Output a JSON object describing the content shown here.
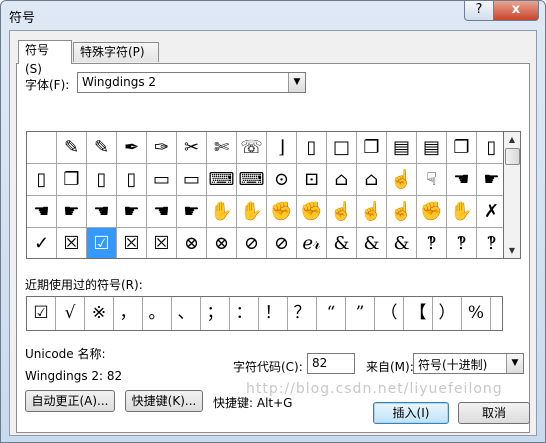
{
  "window": {
    "title": "符号",
    "help_icon": "?",
    "close_icon": "x"
  },
  "tabs": [
    {
      "label": "符号(S)",
      "active": true
    },
    {
      "label": "特殊字符(P)",
      "active": false
    }
  ],
  "font": {
    "label": "字体(F):",
    "value": "Wingdings 2"
  },
  "symbol_grid": {
    "rows": [
      [
        "",
        "✎",
        "✎",
        "✒",
        "✑",
        "✂",
        "✄",
        "☏",
        "⌋",
        "▯",
        "□",
        "❐",
        "▤",
        "▤",
        "❐",
        "▯"
      ],
      [
        "▯",
        "❐",
        "▯",
        "▯",
        "▭",
        "▭",
        "⌨",
        "⌨",
        "⊙",
        "⊡",
        "⌂",
        "⌂",
        "☝",
        "☟",
        "☚",
        "☛"
      ],
      [
        "☚",
        "☛",
        "☚",
        "☛",
        "☚",
        "☛",
        "✋",
        "✋",
        "✊",
        "✊",
        "☝",
        "☝",
        "☝",
        "✊",
        "✋",
        "✗"
      ],
      [
        "✓",
        "☒",
        "☑",
        "☒",
        "☒",
        "⊗",
        "⊗",
        "⊘",
        "⊘",
        "ℯ𝓇",
        "&",
        "&",
        "&",
        "‽",
        "‽",
        "‽"
      ]
    ],
    "selected": {
      "row": 3,
      "col": 2
    }
  },
  "recent": {
    "label": "近期使用过的符号(R):",
    "symbols": [
      "☑",
      "√",
      "※",
      "，",
      "。",
      "、",
      "；",
      "：",
      "！",
      "？",
      "“",
      "”",
      "（",
      "【",
      "）",
      "%"
    ]
  },
  "unicode_name_label": "Unicode 名称:",
  "char_name": "Wingdings 2: 82",
  "char_code": {
    "label": "字符代码(C):",
    "value": "82"
  },
  "from": {
    "label": "来自(M):",
    "value": "符号(十进制)"
  },
  "buttons": {
    "autocorrect": "自动更正(A)...",
    "shortcut_key": "快捷键(K)...",
    "insert": "插入(I)",
    "cancel": "取消"
  },
  "shortcut_text": "快捷键: Alt+G",
  "watermark": "http://blog.csdn.net/liyuefeilong"
}
